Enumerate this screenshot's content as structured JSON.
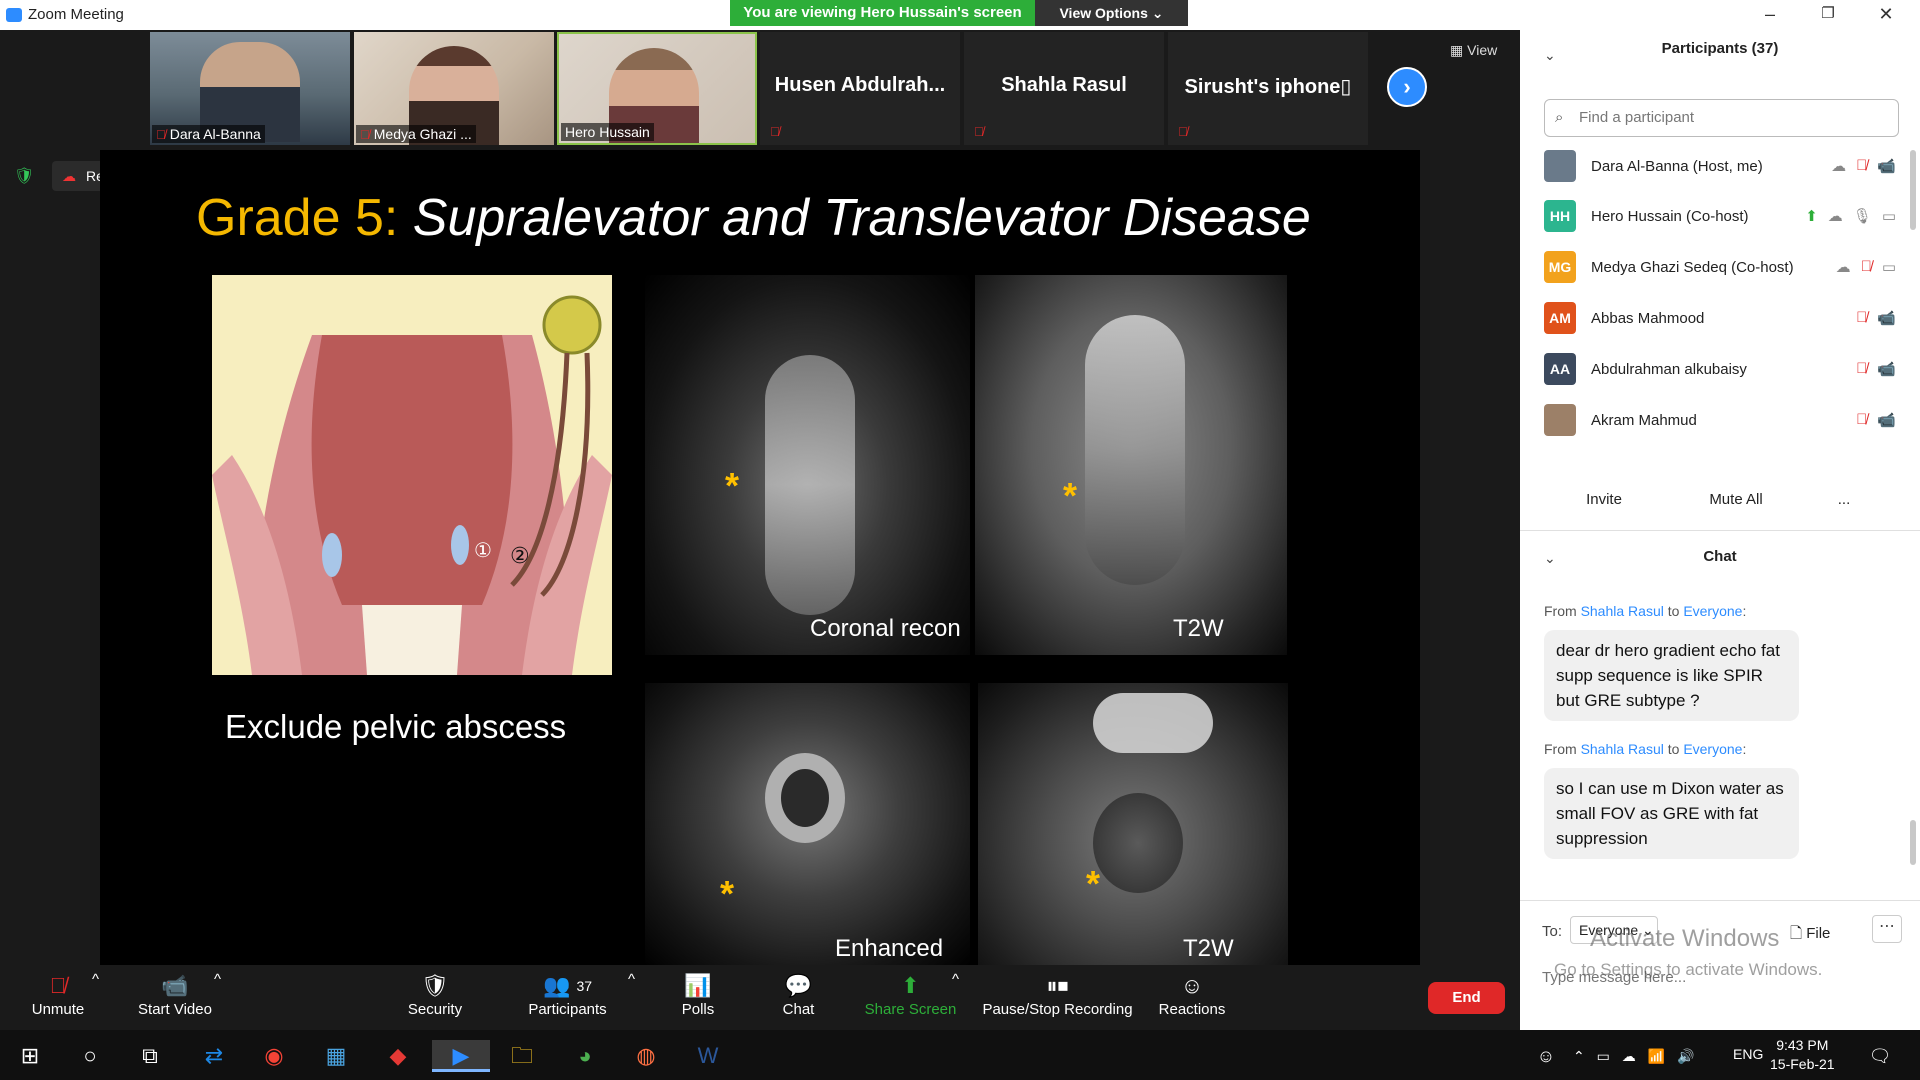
{
  "titlebar": {
    "title": "Zoom Meeting",
    "viewing_banner": "You are viewing Hero Hussain's screen",
    "view_options": "View Options ⌄",
    "minimize": "–",
    "restore": "❐",
    "close": "✕"
  },
  "thumbnails": [
    {
      "name": "Dara Al-Banna",
      "video": true
    },
    {
      "name": "Medya Ghazi ...",
      "video": true
    },
    {
      "name": "Hero Hussain",
      "video": true,
      "active": true
    },
    {
      "name": "Husen  Abdulrah...",
      "video": false
    },
    {
      "name": "Shahla Rasul",
      "video": false
    },
    {
      "name": "Sirusht's  iphone▯",
      "video": false
    }
  ],
  "view_label": "View",
  "recording": {
    "label": "Recording...",
    "pause": "❚❚",
    "stop": "■"
  },
  "slide": {
    "title_grade": "Grade 5:",
    "title_rest": "Supralevator and Translevator Disease",
    "exclude_text": "Exclude pelvic abscess",
    "captions": {
      "coronal": "Coronal recon",
      "t2w_top": "T2W",
      "enhanced": "Enhanced",
      "t2w_bottom": "T2W"
    },
    "diagram_markers": [
      "①",
      "②"
    ],
    "asterisk": "*"
  },
  "toolbar": {
    "unmute": "Unmute",
    "start_video": "Start Video",
    "security": "Security",
    "participants": "Participants",
    "participants_count": "37",
    "polls": "Polls",
    "chat": "Chat",
    "share_screen": "Share Screen",
    "pause_stop": "Pause/Stop Recording",
    "reactions": "Reactions",
    "end": "End"
  },
  "participants_panel": {
    "title": "Participants (37)",
    "search_placeholder": "Find a participant",
    "people": [
      {
        "name": "Dara Al-Banna (Host, me)",
        "initials": "",
        "color": "#6a7a8a"
      },
      {
        "name": "Hero Hussain (Co-host)",
        "initials": "HH",
        "color": "#2cb58f"
      },
      {
        "name": "Medya Ghazi Sedeq (Co-host)",
        "initials": "MG",
        "color": "#f2a21d"
      },
      {
        "name": "Abbas Mahmood",
        "initials": "AM",
        "color": "#e0521b"
      },
      {
        "name": "Abdulrahman  alkubaisy",
        "initials": "AA",
        "color": "#3c4a5e"
      },
      {
        "name": "Akram Mahmud",
        "initials": "",
        "color": "#9c8068"
      }
    ],
    "invite": "Invite",
    "mute_all": "Mute All",
    "more": "..."
  },
  "chat_panel": {
    "title": "Chat",
    "messages": [
      {
        "from_prefix": "From",
        "from": "Shahla Rasul",
        "to_prefix": "to",
        "to": "Everyone",
        "text": "dear dr hero gradient echo fat supp sequence is like SPIR but GRE subtype ?"
      },
      {
        "from_prefix": "From",
        "from": "Shahla Rasul",
        "to_prefix": "to",
        "to": "Everyone",
        "text": "so I can use m Dixon water as small FOV as GRE with fat suppression"
      }
    ],
    "to_label": "To:",
    "recipient": "Everyone",
    "file_label": "File",
    "more": "⋯",
    "input_placeholder": "Type message here..."
  },
  "watermark": {
    "line1": "Activate Windows",
    "line2": "Go to Settings to activate Windows."
  },
  "taskbar": {
    "time": "9:43 PM",
    "date": "15-Feb-21",
    "lang": "ENG"
  }
}
